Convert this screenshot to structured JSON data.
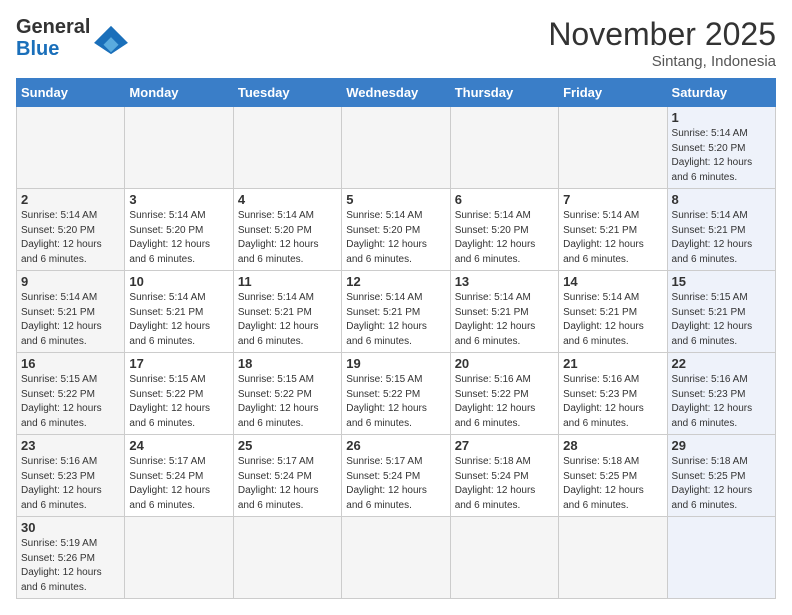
{
  "header": {
    "logo_text_general": "General",
    "logo_text_blue": "Blue",
    "month_title": "November 2025",
    "subtitle": "Sintang, Indonesia"
  },
  "days_of_week": [
    "Sunday",
    "Monday",
    "Tuesday",
    "Wednesday",
    "Thursday",
    "Friday",
    "Saturday"
  ],
  "weeks": [
    [
      {
        "day": "",
        "info": ""
      },
      {
        "day": "",
        "info": ""
      },
      {
        "day": "",
        "info": ""
      },
      {
        "day": "",
        "info": ""
      },
      {
        "day": "",
        "info": ""
      },
      {
        "day": "",
        "info": ""
      },
      {
        "day": "1",
        "info": "Sunrise: 5:14 AM\nSunset: 5:20 PM\nDaylight: 12 hours and 6 minutes."
      }
    ],
    [
      {
        "day": "2",
        "info": "Sunrise: 5:14 AM\nSunset: 5:20 PM\nDaylight: 12 hours and 6 minutes."
      },
      {
        "day": "3",
        "info": "Sunrise: 5:14 AM\nSunset: 5:20 PM\nDaylight: 12 hours and 6 minutes."
      },
      {
        "day": "4",
        "info": "Sunrise: 5:14 AM\nSunset: 5:20 PM\nDaylight: 12 hours and 6 minutes."
      },
      {
        "day": "5",
        "info": "Sunrise: 5:14 AM\nSunset: 5:20 PM\nDaylight: 12 hours and 6 minutes."
      },
      {
        "day": "6",
        "info": "Sunrise: 5:14 AM\nSunset: 5:20 PM\nDaylight: 12 hours and 6 minutes."
      },
      {
        "day": "7",
        "info": "Sunrise: 5:14 AM\nSunset: 5:21 PM\nDaylight: 12 hours and 6 minutes."
      },
      {
        "day": "8",
        "info": "Sunrise: 5:14 AM\nSunset: 5:21 PM\nDaylight: 12 hours and 6 minutes."
      }
    ],
    [
      {
        "day": "9",
        "info": "Sunrise: 5:14 AM\nSunset: 5:21 PM\nDaylight: 12 hours and 6 minutes."
      },
      {
        "day": "10",
        "info": "Sunrise: 5:14 AM\nSunset: 5:21 PM\nDaylight: 12 hours and 6 minutes."
      },
      {
        "day": "11",
        "info": "Sunrise: 5:14 AM\nSunset: 5:21 PM\nDaylight: 12 hours and 6 minutes."
      },
      {
        "day": "12",
        "info": "Sunrise: 5:14 AM\nSunset: 5:21 PM\nDaylight: 12 hours and 6 minutes."
      },
      {
        "day": "13",
        "info": "Sunrise: 5:14 AM\nSunset: 5:21 PM\nDaylight: 12 hours and 6 minutes."
      },
      {
        "day": "14",
        "info": "Sunrise: 5:14 AM\nSunset: 5:21 PM\nDaylight: 12 hours and 6 minutes."
      },
      {
        "day": "15",
        "info": "Sunrise: 5:15 AM\nSunset: 5:21 PM\nDaylight: 12 hours and 6 minutes."
      }
    ],
    [
      {
        "day": "16",
        "info": "Sunrise: 5:15 AM\nSunset: 5:22 PM\nDaylight: 12 hours and 6 minutes."
      },
      {
        "day": "17",
        "info": "Sunrise: 5:15 AM\nSunset: 5:22 PM\nDaylight: 12 hours and 6 minutes."
      },
      {
        "day": "18",
        "info": "Sunrise: 5:15 AM\nSunset: 5:22 PM\nDaylight: 12 hours and 6 minutes."
      },
      {
        "day": "19",
        "info": "Sunrise: 5:15 AM\nSunset: 5:22 PM\nDaylight: 12 hours and 6 minutes."
      },
      {
        "day": "20",
        "info": "Sunrise: 5:16 AM\nSunset: 5:22 PM\nDaylight: 12 hours and 6 minutes."
      },
      {
        "day": "21",
        "info": "Sunrise: 5:16 AM\nSunset: 5:23 PM\nDaylight: 12 hours and 6 minutes."
      },
      {
        "day": "22",
        "info": "Sunrise: 5:16 AM\nSunset: 5:23 PM\nDaylight: 12 hours and 6 minutes."
      }
    ],
    [
      {
        "day": "23",
        "info": "Sunrise: 5:16 AM\nSunset: 5:23 PM\nDaylight: 12 hours and 6 minutes."
      },
      {
        "day": "24",
        "info": "Sunrise: 5:17 AM\nSunset: 5:24 PM\nDaylight: 12 hours and 6 minutes."
      },
      {
        "day": "25",
        "info": "Sunrise: 5:17 AM\nSunset: 5:24 PM\nDaylight: 12 hours and 6 minutes."
      },
      {
        "day": "26",
        "info": "Sunrise: 5:17 AM\nSunset: 5:24 PM\nDaylight: 12 hours and 6 minutes."
      },
      {
        "day": "27",
        "info": "Sunrise: 5:18 AM\nSunset: 5:24 PM\nDaylight: 12 hours and 6 minutes."
      },
      {
        "day": "28",
        "info": "Sunrise: 5:18 AM\nSunset: 5:25 PM\nDaylight: 12 hours and 6 minutes."
      },
      {
        "day": "29",
        "info": "Sunrise: 5:18 AM\nSunset: 5:25 PM\nDaylight: 12 hours and 6 minutes."
      }
    ],
    [
      {
        "day": "30",
        "info": "Sunrise: 5:19 AM\nSunset: 5:26 PM\nDaylight: 12 hours and 6 minutes."
      },
      {
        "day": "",
        "info": ""
      },
      {
        "day": "",
        "info": ""
      },
      {
        "day": "",
        "info": ""
      },
      {
        "day": "",
        "info": ""
      },
      {
        "day": "",
        "info": ""
      },
      {
        "day": "",
        "info": ""
      }
    ]
  ]
}
